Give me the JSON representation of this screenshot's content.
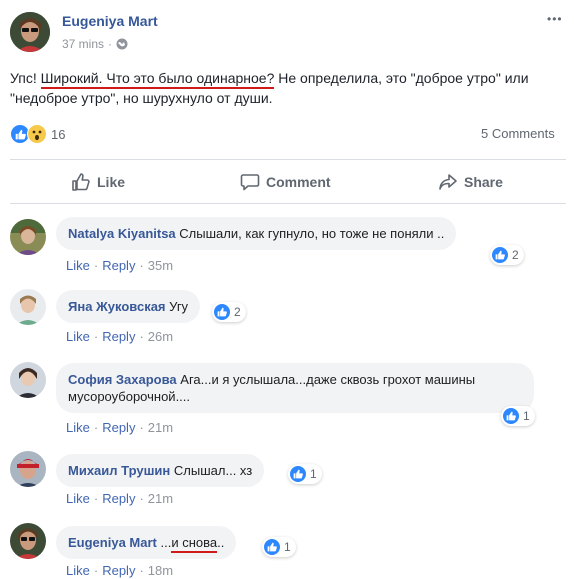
{
  "post": {
    "author": "Eugeniya Mart",
    "time": "37 mins",
    "text_part1": "Упс! ",
    "text_part2": "Широкий. Что это было одинарное?",
    "text_part3": " Не определила, это \"доброе утро\" или \"недоброе утро\", но шурухнуло от души.",
    "reactions_count": "16",
    "comments_count": "5 Comments",
    "more_label": "•••"
  },
  "actions": {
    "like": "Like",
    "comment": "Comment",
    "share": "Share"
  },
  "comments": [
    {
      "author": "Natalya Kiyanitsa",
      "text": "Слышали, как гупнуло, но тоже не поняли ..",
      "like": "Like",
      "reply": "Reply",
      "time": "35m",
      "reactions": "2"
    },
    {
      "author": "Яна Жуковская",
      "text": "Угу",
      "like": "Like",
      "reply": "Reply",
      "time": "26m",
      "reactions": "2"
    },
    {
      "author": "София Захарова",
      "text": "Ага...и я услышала...даже сквозь грохот машины мусороуборочной....",
      "like": "Like",
      "reply": "Reply",
      "time": "21m",
      "reactions": "1"
    },
    {
      "author": "Михаил Трушин",
      "text": "Слышал... хз",
      "like": "Like",
      "reply": "Reply",
      "time": "21m",
      "reactions": "1"
    },
    {
      "author": "Eugeniya Mart",
      "text_pre": "...",
      "text_under": "и снова",
      "text_post": "..",
      "like": "Like",
      "reply": "Reply",
      "time": "18m",
      "reactions": "1"
    }
  ],
  "colors": {
    "link": "#385898",
    "accent": "#2d88ff",
    "underline": "#d01a1a"
  }
}
